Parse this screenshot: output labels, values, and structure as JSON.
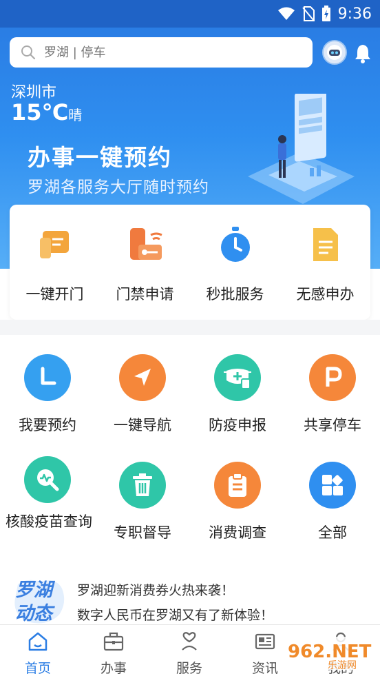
{
  "status_bar": {
    "time": "9:36"
  },
  "search": {
    "placeholder": "罗湖 | 停车"
  },
  "weather": {
    "city": "深圳市",
    "temperature": "15℃",
    "condition": "晴"
  },
  "banner": {
    "title": "办事一键预约",
    "subtitle": "罗湖各服务大厅随时预约"
  },
  "quick_actions": [
    {
      "label": "一键开门",
      "icon": "door-card-icon",
      "color": "#f3a53c"
    },
    {
      "label": "门禁申请",
      "icon": "access-key-icon",
      "color": "#f07a3e"
    },
    {
      "label": "秒批服务",
      "icon": "stopwatch-icon",
      "color": "#2f8ff0"
    },
    {
      "label": "无感申办",
      "icon": "document-icon",
      "color": "#f6c04a"
    }
  ],
  "services": [
    {
      "label": "我要预约",
      "icon": "clock-icon",
      "color": "#35a0f0"
    },
    {
      "label": "一键导航",
      "icon": "navigation-arrow-icon",
      "color": "#f5873a"
    },
    {
      "label": "防疫申报",
      "icon": "mask-icon",
      "color": "#2fc6a8"
    },
    {
      "label": "共享停车",
      "icon": "parking-icon",
      "color": "#f5873a"
    },
    {
      "label": "核酸疫苗查询",
      "icon": "health-search-icon",
      "color": "#2fc6a8"
    },
    {
      "label": "专职督导",
      "icon": "trash-icon",
      "color": "#2fc6a8"
    },
    {
      "label": "消费调查",
      "icon": "clipboard-icon",
      "color": "#f5873a"
    },
    {
      "label": "全部",
      "icon": "grid-icon",
      "color": "#2f8ff0"
    }
  ],
  "news": {
    "logo_text": "罗湖动态",
    "items": [
      "罗湖迎新消费券火热来袭！",
      "数字人民币在罗湖又有了新体验！"
    ]
  },
  "bottom_nav": [
    {
      "label": "首页",
      "icon": "home-icon",
      "active": true
    },
    {
      "label": "办事",
      "icon": "briefcase-icon",
      "active": false
    },
    {
      "label": "服务",
      "icon": "service-heart-icon",
      "active": false
    },
    {
      "label": "资讯",
      "icon": "newspaper-icon",
      "active": false
    },
    {
      "label": "我的",
      "icon": "user-icon",
      "active": false
    }
  ],
  "watermark": {
    "text": "962.NET",
    "sub": "乐游网"
  },
  "colors": {
    "primary": "#2a7de4",
    "status_bar": "#1f63c6"
  }
}
